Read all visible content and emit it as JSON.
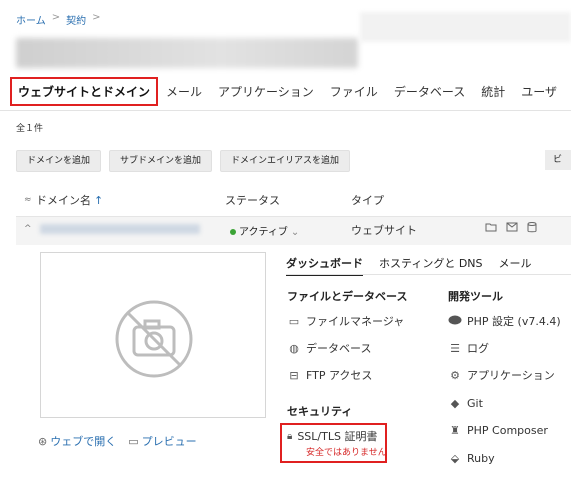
{
  "breadcrumb": {
    "home": "ホーム",
    "contract": "契約",
    "sep": ">"
  },
  "tabs": [
    "ウェブサイトとドメイン",
    "メール",
    "アプリケーション",
    "ファイル",
    "データベース",
    "統計",
    "ユーザ"
  ],
  "count_text": "全１件",
  "buttons": {
    "add_domain": "ドメインを追加",
    "add_subdomain": "サブドメインを追加",
    "add_alias": "ドメインエイリアスを追加",
    "right_partial": "ビ"
  },
  "columns": {
    "domain": "ドメイン名",
    "status": "ステータス",
    "type": "タイプ",
    "sort_arrow": "↑",
    "collapse_icon": "≈"
  },
  "row": {
    "status": "アクティブ",
    "type": "ウェブサイト",
    "chevron": "⌄",
    "status_color": "#3aa335"
  },
  "left_links": {
    "open_web": "ウェブで開く",
    "preview": "プレビュー"
  },
  "subtabs": [
    "ダッシュボード",
    "ホスティングと DNS",
    "メール"
  ],
  "sections": {
    "files_db": {
      "title": "ファイルとデータベース",
      "items": [
        "ファイルマネージャ",
        "データベース",
        "FTP アクセス"
      ]
    },
    "dev_tools": {
      "title": "開発ツール",
      "items": [
        "PHP 設定 (v7.4.4)",
        "ログ",
        "アプリケーション",
        "Git",
        "PHP Composer",
        "Ruby"
      ]
    },
    "security": {
      "title": "セキュリティ",
      "ssl_label": "SSL/TLS 証明書",
      "ssl_warning": "安全ではありません"
    }
  },
  "colors": {
    "accent_red": "#e02020",
    "link_blue": "#2a6fb0",
    "warn_red": "#d62828"
  }
}
